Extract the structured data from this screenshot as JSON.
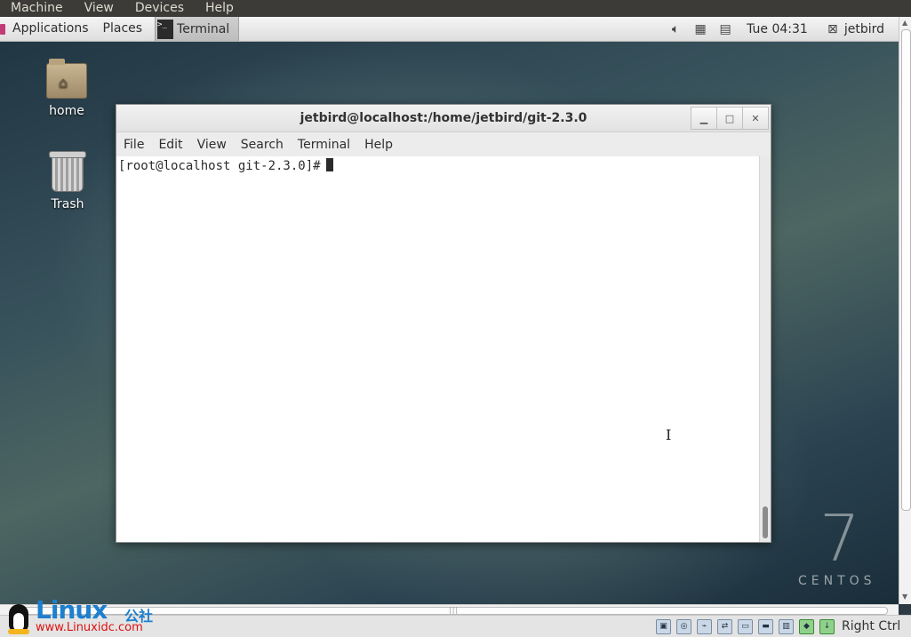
{
  "host_menu": [
    "Machine",
    "View",
    "Devices",
    "Help"
  ],
  "gnome_panel": {
    "applications": "Applications",
    "places": "Places",
    "task_title": "Terminal",
    "clock": "Tue 04:31",
    "user": "jetbird"
  },
  "desktop": {
    "icons": [
      {
        "label": "home",
        "icon": "home-folder-icon"
      },
      {
        "label": "Trash",
        "icon": "trash-icon"
      }
    ],
    "watermark_number": "7",
    "watermark_word": "CENTOS"
  },
  "terminal": {
    "title": "jetbird@localhost:/home/jetbird/git-2.3.0",
    "window_buttons": [
      "minimize",
      "maximize",
      "close"
    ],
    "menu": [
      "File",
      "Edit",
      "View",
      "Search",
      "Terminal",
      "Help"
    ],
    "prompt": "[root@localhost git-2.3.0]#"
  },
  "statusbar": {
    "host_key": "Right Ctrl"
  },
  "logo_watermark": {
    "brand": "Linux",
    "chinese": "公社",
    "url": "www.Linuxidc.com"
  }
}
